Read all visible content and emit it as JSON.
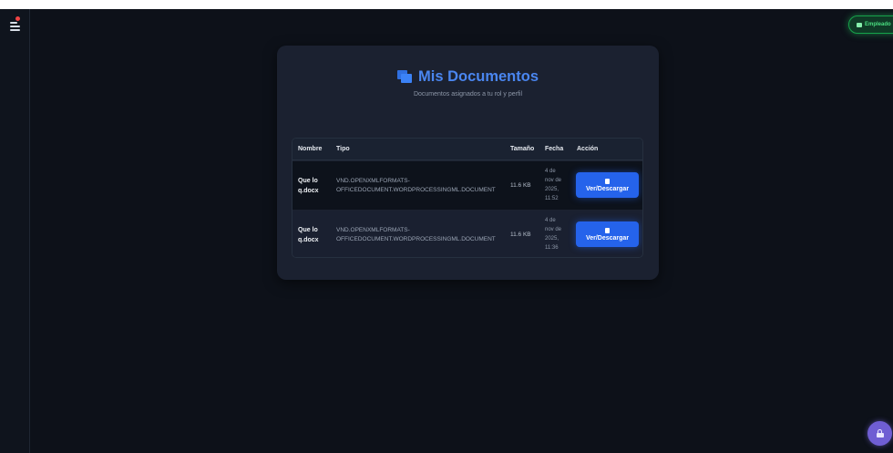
{
  "header": {
    "role_badge": "Empleado",
    "role_badge_color": "#4ade80"
  },
  "card": {
    "title": "Mis Documentos",
    "subtitle": "Documentos asignados a tu rol y perfil",
    "title_icon": "folder-icon",
    "accent": "#4a86f0"
  },
  "table": {
    "headers": [
      "Nombre",
      "Tipo",
      "Tamaño",
      "Fecha",
      "Acción"
    ],
    "rows": [
      {
        "name_line1": "Que lo",
        "name_line2": "q.docx",
        "type_line1": "VND.OPENXMLFORMATS-",
        "type_line2": "OFFICEDOCUMENT.WORDPROCESSINGML.DOCUMENT",
        "size": "11.6 KB",
        "date_line1": "4 de",
        "date_line2": "nov de",
        "date_line3": "2025,",
        "date_line4": "11:52",
        "action": "Ver/Descargar"
      },
      {
        "name_line1": "Que lo",
        "name_line2": "q.docx",
        "type_line1": "VND.OPENXMLFORMATS-",
        "type_line2": "OFFICEDOCUMENT.WORDPROCESSINGML.DOCUMENT",
        "size": "11.6 KB",
        "date_line1": "4 de",
        "date_line2": "nov de",
        "date_line3": "2025,",
        "date_line4": "11:36",
        "action": "Ver/Descargar"
      }
    ]
  },
  "colors": {
    "background": "#0d1119",
    "card": "#1b2130",
    "button": "#2563eb",
    "fab": "#6f5ed3"
  }
}
